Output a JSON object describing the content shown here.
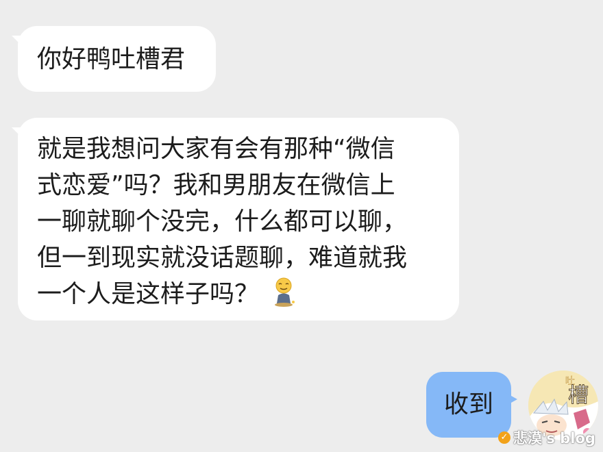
{
  "chat": {
    "messages": [
      {
        "direction": "incoming",
        "lines": [
          "你好鸭吐槽君"
        ]
      },
      {
        "direction": "incoming",
        "lines": [
          "就是我想问大家有会有那种“微信",
          "式恋爱”吗？我和男朋友在微信上",
          "一聊就聊个没完，什么都可以聊，",
          "但一到现实就没话题聊，难道就我",
          "一个人是这样子吗？"
        ],
        "emoji": "kneeling-emoji-icon"
      },
      {
        "direction": "outgoing",
        "lines": [
          "收到"
        ]
      }
    ],
    "avatar_text": "吐槽"
  },
  "watermark": {
    "text": "悲漠's blog",
    "icon": "check-badge-icon"
  },
  "colors": {
    "background": "#ededed",
    "incoming_bubble": "#ffffff",
    "outgoing_bubble": "#85b8f7",
    "text": "#1c1c1c"
  }
}
